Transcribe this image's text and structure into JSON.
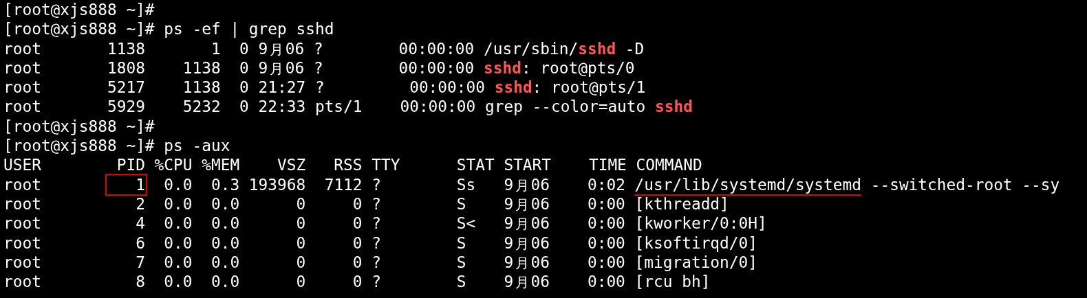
{
  "terminal": {
    "lines": [
      {
        "segments": [
          {
            "kind": "plain",
            "text": "[root@xjs888 ~]#"
          }
        ]
      },
      {
        "segments": [
          {
            "kind": "plain",
            "text": "[root@xjs888 ~]# ps -ef | grep sshd"
          }
        ]
      },
      {
        "segments": [
          {
            "kind": "plain",
            "text": "root       1138       1  0 9月06 ?        00:00:00 /usr/sbin/"
          },
          {
            "kind": "match",
            "text": "sshd"
          },
          {
            "kind": "plain",
            "text": " -D"
          }
        ]
      },
      {
        "segments": [
          {
            "kind": "plain",
            "text": "root       1808    1138  0 9月06 ?        00:00:00 "
          },
          {
            "kind": "match",
            "text": "sshd"
          },
          {
            "kind": "plain",
            "text": ": root@pts/0"
          }
        ]
      },
      {
        "segments": [
          {
            "kind": "plain",
            "text": "root       5217    1138  0 21:27 ?         00:00:00 "
          },
          {
            "kind": "match",
            "text": "sshd"
          },
          {
            "kind": "plain",
            "text": ": root@pts/1"
          }
        ]
      },
      {
        "segments": [
          {
            "kind": "plain",
            "text": "root       5929    5232  0 22:33 pts/1    00:00:00 grep --color=auto "
          },
          {
            "kind": "match",
            "text": "sshd"
          }
        ]
      },
      {
        "segments": [
          {
            "kind": "plain",
            "text": "[root@xjs888 ~]#"
          }
        ]
      },
      {
        "segments": [
          {
            "kind": "plain",
            "text": "[root@xjs888 ~]# ps -aux"
          }
        ]
      },
      {
        "segments": [
          {
            "kind": "plain",
            "text": "USER        PID %CPU %MEM    VSZ   RSS TTY      STAT START    TIME COMMAND"
          }
        ]
      },
      {
        "segments": [
          {
            "kind": "plain",
            "text": "root       "
          },
          {
            "kind": "boxed",
            "text": "   1"
          },
          {
            "kind": "plain",
            "text": "  0.0  0.3 193968  7112 ?        Ss   9月06    0:02 "
          },
          {
            "kind": "underlined",
            "text": "/usr/lib/systemd/systemd"
          },
          {
            "kind": "plain",
            "text": " --switched-root --sy"
          }
        ]
      },
      {
        "segments": [
          {
            "kind": "plain",
            "text": "root          2  0.0  0.0      0     0 ?        S    9月06    0:00 [kthreadd]"
          }
        ]
      },
      {
        "segments": [
          {
            "kind": "plain",
            "text": "root          4  0.0  0.0      0     0 ?        S<   9月06    0:00 [kworker/0:0H]"
          }
        ]
      },
      {
        "segments": [
          {
            "kind": "plain",
            "text": "root          6  0.0  0.0      0     0 ?        S    9月06    0:00 [ksoftirqd/0]"
          }
        ]
      },
      {
        "segments": [
          {
            "kind": "plain",
            "text": "root          7  0.0  0.0      0     0 ?        S    9月06    0:00 [migration/0]"
          }
        ]
      },
      {
        "segments": [
          {
            "kind": "plain",
            "text": "root          8  0.0  0.0      0     0 ?        S    9月06    0:00 [rcu bh]"
          }
        ]
      }
    ]
  }
}
